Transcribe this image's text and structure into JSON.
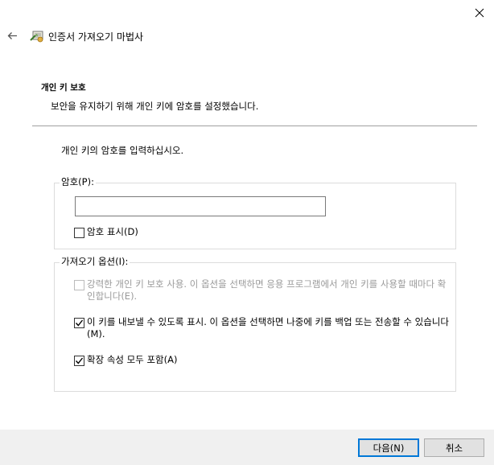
{
  "window": {
    "title": "인증서 가져오기 마법사"
  },
  "icons": {
    "close": "close-icon",
    "back": "back-arrow-icon",
    "wizard": "certificate-wizard-icon"
  },
  "header": {
    "title": "개인 키 보호",
    "description": "보안을 유지하기 위해 개인 키에 암호를 설정했습니다."
  },
  "instruction": "개인 키의 암호를 입력하십시오.",
  "password_group": {
    "legend": "암호(P):",
    "input_value": "",
    "show_password_label": "암호 표시(D)",
    "show_password_checked": false
  },
  "options_group": {
    "legend": "가져오기 옵션(I):",
    "options": [
      {
        "label": "강력한 개인 키 보호 사용. 이 옵션을 선택하면 응용 프로그램에서 개인 키를 사용할 때마다 확인합니다(E).",
        "checked": false,
        "enabled": false
      },
      {
        "label": "이 키를 내보낼 수 있도록 표시. 이 옵션을 선택하면 나중에 키를 백업 또는 전송할 수 있습니다(M).",
        "checked": true,
        "enabled": true
      },
      {
        "label": "확장 속성 모두 포함(A)",
        "checked": true,
        "enabled": true
      }
    ]
  },
  "footer": {
    "next_label": "다음(N)",
    "cancel_label": "취소"
  },
  "colors": {
    "divider": "#a0a0a0",
    "footer_bg": "#f0f0f0",
    "default_button_border": "#0078d7",
    "disabled_text": "#9a9a9a"
  }
}
